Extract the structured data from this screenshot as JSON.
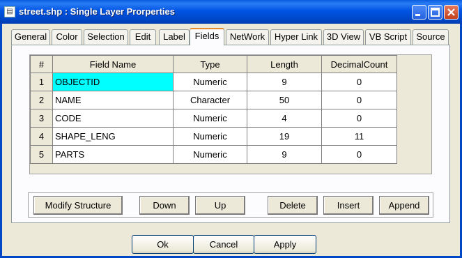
{
  "window": {
    "title": "street.shp  : Single Layer Prorperties"
  },
  "tabs": [
    {
      "label": "General"
    },
    {
      "label": "Color"
    },
    {
      "label": "Selection"
    },
    {
      "label": "Edit"
    },
    {
      "label": "Label"
    },
    {
      "label": "Fields",
      "active": true
    },
    {
      "label": "NetWork"
    },
    {
      "label": "Hyper Link"
    },
    {
      "label": "3D View"
    },
    {
      "label": "VB Script"
    },
    {
      "label": "Source"
    }
  ],
  "grid": {
    "headers": [
      "#",
      "Field Name",
      "Type",
      "Length",
      "DecimalCount"
    ],
    "rows": [
      {
        "num": "1",
        "name": "OBJECTID",
        "type": "Numeric",
        "length": "9",
        "decimal": "0",
        "selected": true
      },
      {
        "num": "2",
        "name": "NAME",
        "type": "Character",
        "length": "50",
        "decimal": "0"
      },
      {
        "num": "3",
        "name": "CODE",
        "type": "Numeric",
        "length": "4",
        "decimal": "0"
      },
      {
        "num": "4",
        "name": "SHAPE_LENG",
        "type": "Numeric",
        "length": "19",
        "decimal": "11"
      },
      {
        "num": "5",
        "name": "PARTS",
        "type": "Numeric",
        "length": "9",
        "decimal": "0"
      }
    ],
    "selection_color": "#00ffff"
  },
  "field_buttons": {
    "modify": "Modify Structure",
    "down": "Down",
    "up": "Up",
    "delete": "Delete",
    "insert": "Insert",
    "append": "Append"
  },
  "dialog_buttons": {
    "ok": "Ok",
    "cancel": "Cancel",
    "apply": "Apply"
  },
  "colors": {
    "titlebar": "#0054e3",
    "active_tab_accent": "#e68b2c",
    "dialog_bg": "#ece9d8"
  }
}
